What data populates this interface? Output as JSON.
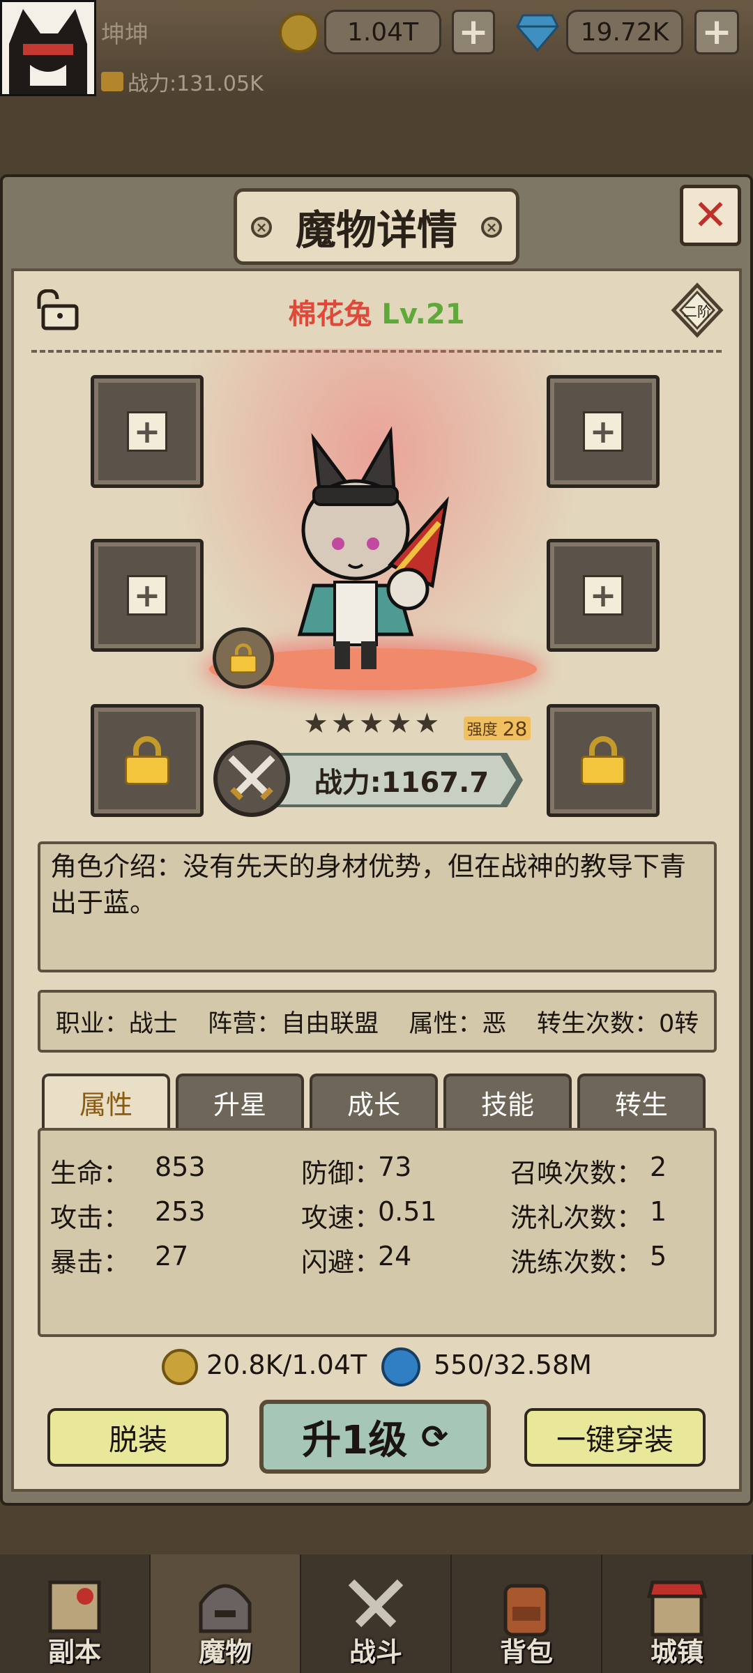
{
  "topbar": {
    "player_name": "坤坤",
    "power_label": "战力:131.05K",
    "gold": "1.04T",
    "diamonds": "19.72K",
    "plus_symbol": "+"
  },
  "panel": {
    "title": "魔物详情",
    "close_symbol": "✕",
    "monster_name": "棉花兔",
    "monster_level": "Lv.21",
    "stage_badge": "二阶",
    "stars": 5,
    "strength_label": "强度",
    "strength_value": "28",
    "combat_power": "战力:1167.7",
    "description": "角色介绍：没有先天的身材优势，但在战神的教导下青出于蓝。",
    "info": {
      "job": "职业：战士",
      "faction": "阵营：自由联盟",
      "attribute": "属性：恶",
      "rebirth": "转生次数：0转"
    },
    "tabs": [
      "属性",
      "升星",
      "成长",
      "技能",
      "转生"
    ],
    "stats": [
      {
        "label": "生命：",
        "value": "853"
      },
      {
        "label": "防御：",
        "value": "73"
      },
      {
        "label": "召唤次数：",
        "value": "2"
      },
      {
        "label": "攻击：",
        "value": "253"
      },
      {
        "label": "攻速：",
        "value": "0.51"
      },
      {
        "label": "洗礼次数：",
        "value": "1"
      },
      {
        "label": "暴击：",
        "value": "27"
      },
      {
        "label": "闪避：",
        "value": "24"
      },
      {
        "label": "洗练次数：",
        "value": "5"
      }
    ],
    "cost_gold": "20.8K/1.04T",
    "cost_essence": "550/32.58M",
    "buttons": {
      "unequip": "脱装",
      "level_up": "升1级",
      "equip_all": "一键穿装"
    }
  },
  "navbar": {
    "items": [
      "副本",
      "魔物",
      "战斗",
      "背包",
      "城镇"
    ],
    "active": "魔物"
  },
  "colors": {
    "monster_name": "#e0483a",
    "monster_level": "#5fa83a",
    "active_tab_text": "#8a5a10",
    "close_x": "#c0302a"
  }
}
